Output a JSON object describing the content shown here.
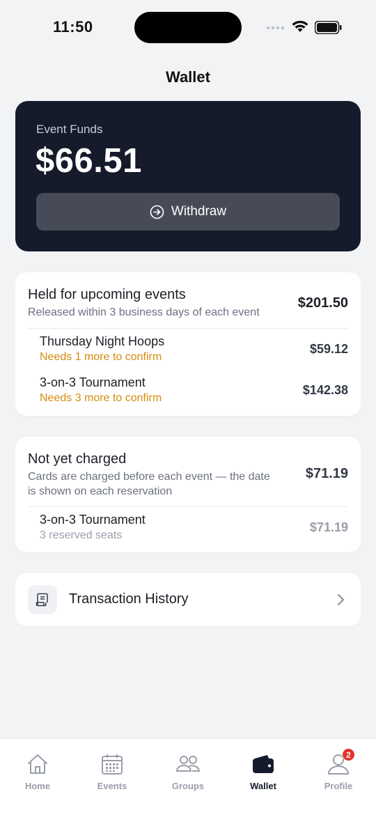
{
  "status_bar": {
    "time": "11:50"
  },
  "header": {
    "title": "Wallet"
  },
  "funds": {
    "label": "Event Funds",
    "amount": "$66.51",
    "withdraw_label": "Withdraw"
  },
  "held": {
    "title": "Held for upcoming events",
    "subtitle": "Released within 3 business days of each event",
    "amount": "$201.50",
    "items": [
      {
        "title": "Thursday Night Hoops",
        "status": "Needs 1 more to confirm",
        "amount": "$59.12"
      },
      {
        "title": "3-on-3 Tournament",
        "status": "Needs 3 more to confirm",
        "amount": "$142.38"
      }
    ]
  },
  "not_charged": {
    "title": "Not yet charged",
    "subtitle_line1": "Cards are charged before each event — the date",
    "subtitle_line2": "is shown on each reservation",
    "amount": "$71.19",
    "items": [
      {
        "title": "3-on-3 Tournament",
        "status": "3 reserved seats",
        "amount": "$71.19"
      }
    ]
  },
  "history": {
    "label": "Transaction History"
  },
  "tabs": [
    {
      "label": "Home",
      "icon": "home-icon"
    },
    {
      "label": "Events",
      "icon": "calendar-icon"
    },
    {
      "label": "Groups",
      "icon": "groups-icon"
    },
    {
      "label": "Wallet",
      "icon": "wallet-icon",
      "active": true
    },
    {
      "label": "Profile",
      "icon": "profile-icon",
      "badge": "2"
    }
  ],
  "colors": {
    "card_dark": "#151b2b",
    "warning": "#d68a0c",
    "badge": "#e0332b",
    "background": "#f2f3f5"
  }
}
